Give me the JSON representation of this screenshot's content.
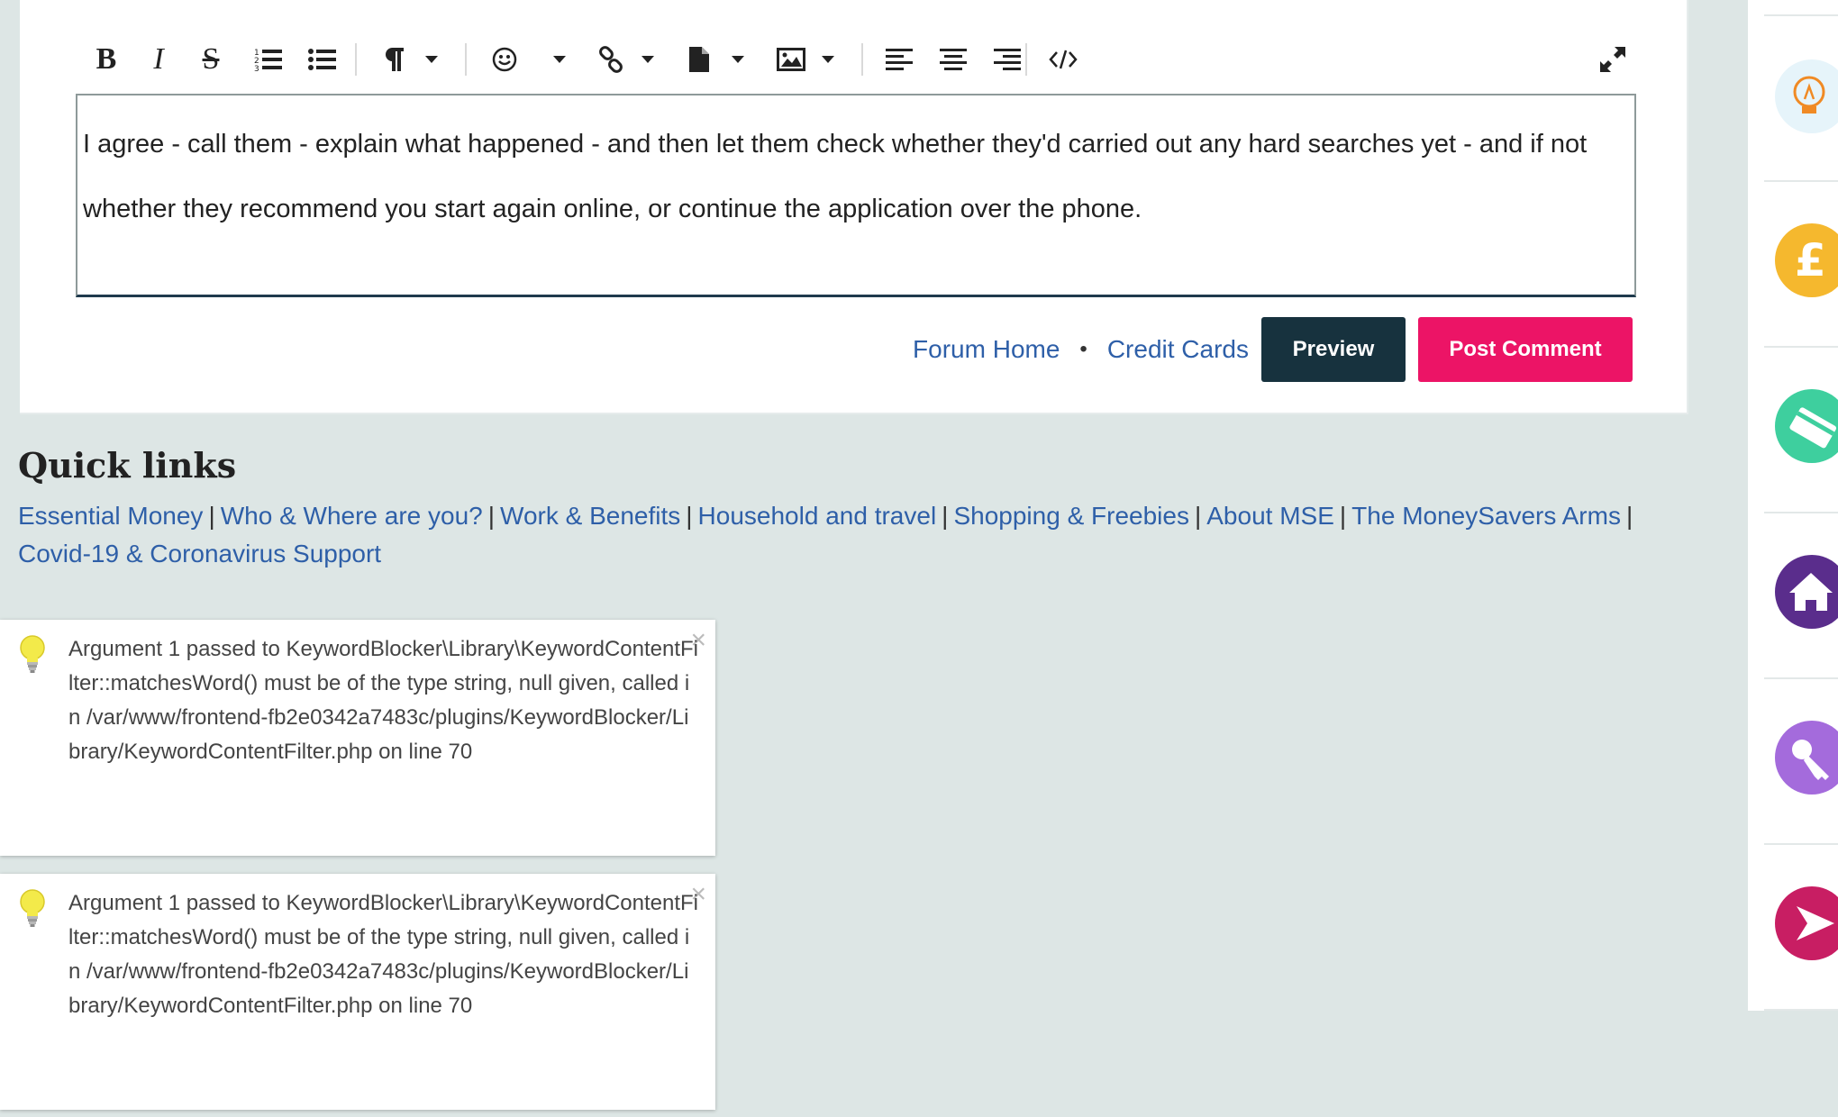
{
  "editor": {
    "toolbar": {
      "bold": "B",
      "italic": "I",
      "strike": "S"
    },
    "body_text": "I agree - call them - explain what happened - and then let them check whether they'd carried out any hard searches yet - and if not whether they recommend you start again online, or continue the application over the phone.",
    "breadcrumb": {
      "home": "Forum Home",
      "separator": "•",
      "category": "Credit Cards"
    },
    "preview_label": "Preview",
    "post_label": "Post Comment",
    "colors": {
      "preview": "#17323e",
      "post": "#ec1466",
      "link": "#2e5fa8"
    }
  },
  "quick_links": {
    "title": "Quick links",
    "items": [
      "Essential Money",
      "Who & Where are you?",
      "Work & Benefits",
      "Household and travel",
      "Shopping & Freebies",
      "About MSE",
      "The MoneySavers Arms",
      "Covid-19 & Coronavirus Support"
    ],
    "separator": "|"
  },
  "notifications": [
    {
      "icon": "lightbulb-icon",
      "message": "Argument 1 passed to KeywordBlocker\\Library\\KeywordContentFilter::matchesWord() must be of the type string, null given, called in /var/www/frontend-fb2e0342a7483c/plugins/KeywordBlocker/Library/KeywordContentFilter.php on line 70",
      "close": "×"
    },
    {
      "icon": "lightbulb-icon",
      "message": "Argument 1 passed to KeywordBlocker\\Library\\KeywordContentFilter::matchesWord() must be of the type string, null given, called in /var/www/frontend-fb2e0342a7483c/plugins/KeywordBlocker/Library/KeywordContentFilter.php on line 70",
      "close": "×"
    }
  ],
  "rail": {
    "icons": [
      {
        "name": "ideas-bulb-icon",
        "color": "#e6f4fa"
      },
      {
        "name": "pound-icon",
        "color": "#f5b82e"
      },
      {
        "name": "card-icon",
        "color": "#3ecf9e"
      },
      {
        "name": "house-icon",
        "color": "#5a2d8c"
      },
      {
        "name": "key-icon",
        "color": "#a46bdc"
      },
      {
        "name": "arrow-icon",
        "color": "#c81e63"
      }
    ]
  }
}
